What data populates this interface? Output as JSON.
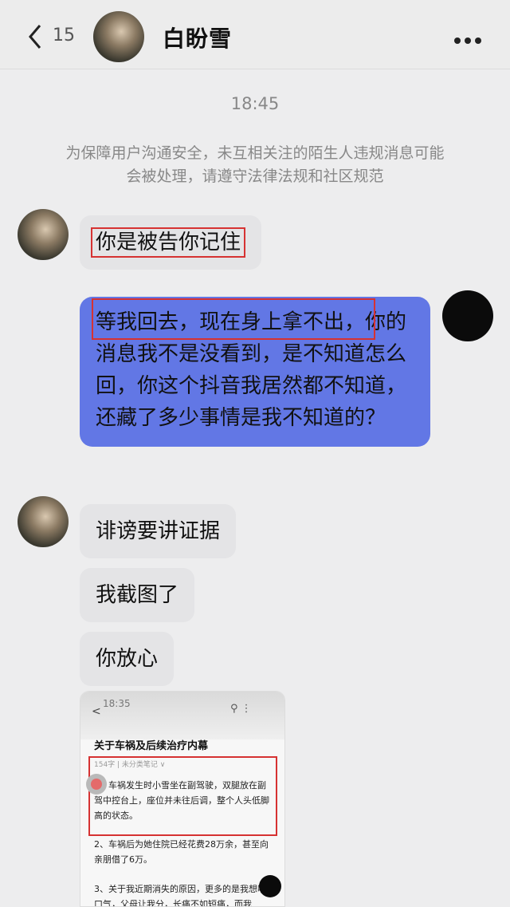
{
  "header": {
    "unread_count": "15",
    "contact_name": "白盼雪"
  },
  "chat": {
    "timestamp": "18:45",
    "notice": "为保障用户沟通安全，未互相关注的陌生人违规消息可能会被处理，请遵守法律法规和社区规范",
    "messages": [
      {
        "from": "them",
        "text": "你是被告你记住"
      },
      {
        "from": "me",
        "highlight": "等我回去，现在身上拿不出",
        "text": "，你的消息我不是没看到，是不知道怎么回，你这个抖音我居然都不知道，还藏了多少事情是我不知道的？"
      },
      {
        "from": "them",
        "text": "诽谤要讲证据"
      },
      {
        "from": "them",
        "text": "我截图了"
      },
      {
        "from": "them",
        "text": "你放心"
      }
    ],
    "screenshot": {
      "time": "18:35",
      "title": "关于车祸及后续治疗内幕",
      "meta": "154字 | 未分类笔记 ∨",
      "para1": "1、车祸发生时小雪坐在副驾驶，双腿放在副驾中控台上，座位并未往后调，整个人头低脚高的状态。",
      "para2": "2、车祸后为她住院已经花费28万余，甚至向亲朋借了6万。",
      "para3": "3、关于我近期消失的原因，更多的是我想喘口气，父母让我分，长痛不如短痛，而我"
    }
  },
  "colors": {
    "sent_bubble": "#6277e5",
    "received_bubble": "#e4e4e6",
    "highlight_box": "#d63232"
  }
}
